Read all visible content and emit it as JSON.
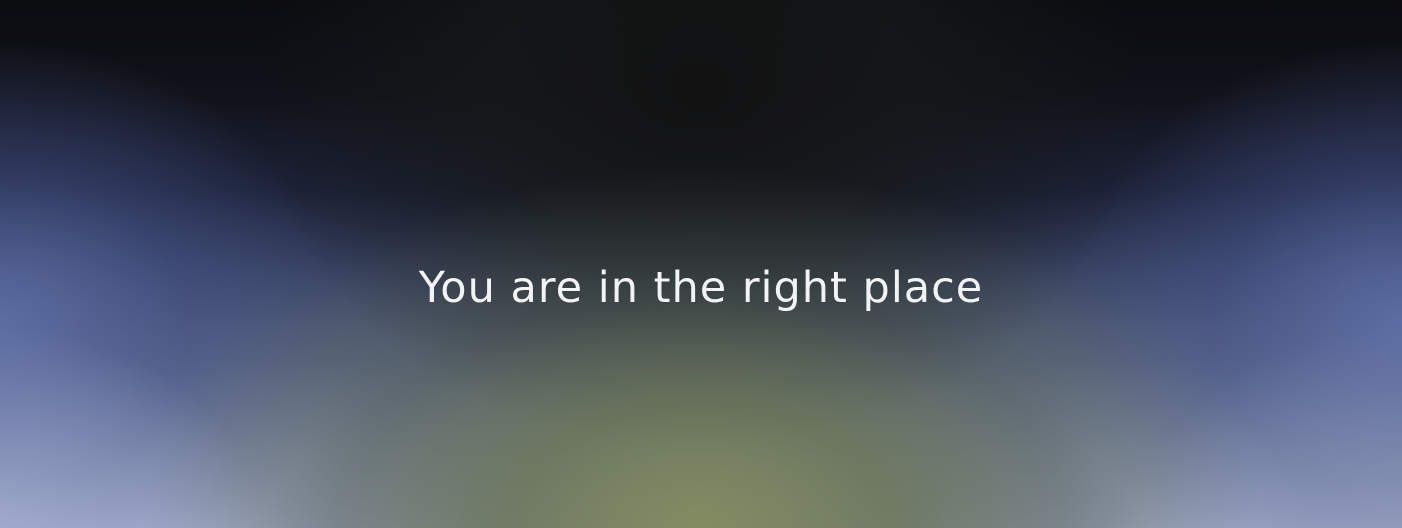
{
  "hero": {
    "headline": "You are in the right place"
  },
  "colors": {
    "top": "#0b0c10",
    "side_blue": "#6070aa",
    "bottom_center_olive": "#848c62",
    "bottom_corner": "#a6b0cc",
    "headline_text": "#f2f3f5"
  }
}
